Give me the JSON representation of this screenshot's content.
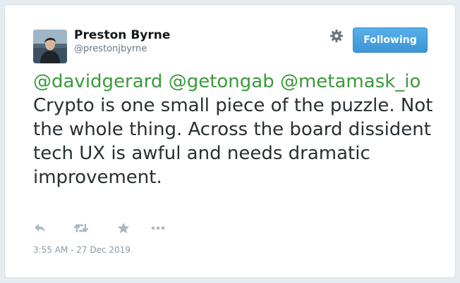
{
  "tweet": {
    "author": {
      "name": "Preston Byrne",
      "handle": "@prestonjbyrne"
    },
    "follow_button": "Following",
    "mentions": [
      "@davidgerard",
      "@getongab",
      "@metamask_io"
    ],
    "body": "Crypto is one small piece of the puzzle. Not the whole thing. Across the board dissident tech UX is awful and needs dramatic improvement.",
    "timestamp": "3:55 AM - 27 Dec 2019"
  },
  "icons": {
    "settings": "gear-icon",
    "reply": "reply-icon",
    "retweet": "retweet-icon",
    "like": "star-icon",
    "more": "more-icon"
  },
  "colors": {
    "mention": "#3a9a3a",
    "button": "#4aa3df",
    "text": "#292f33",
    "muted": "#8899a6"
  }
}
